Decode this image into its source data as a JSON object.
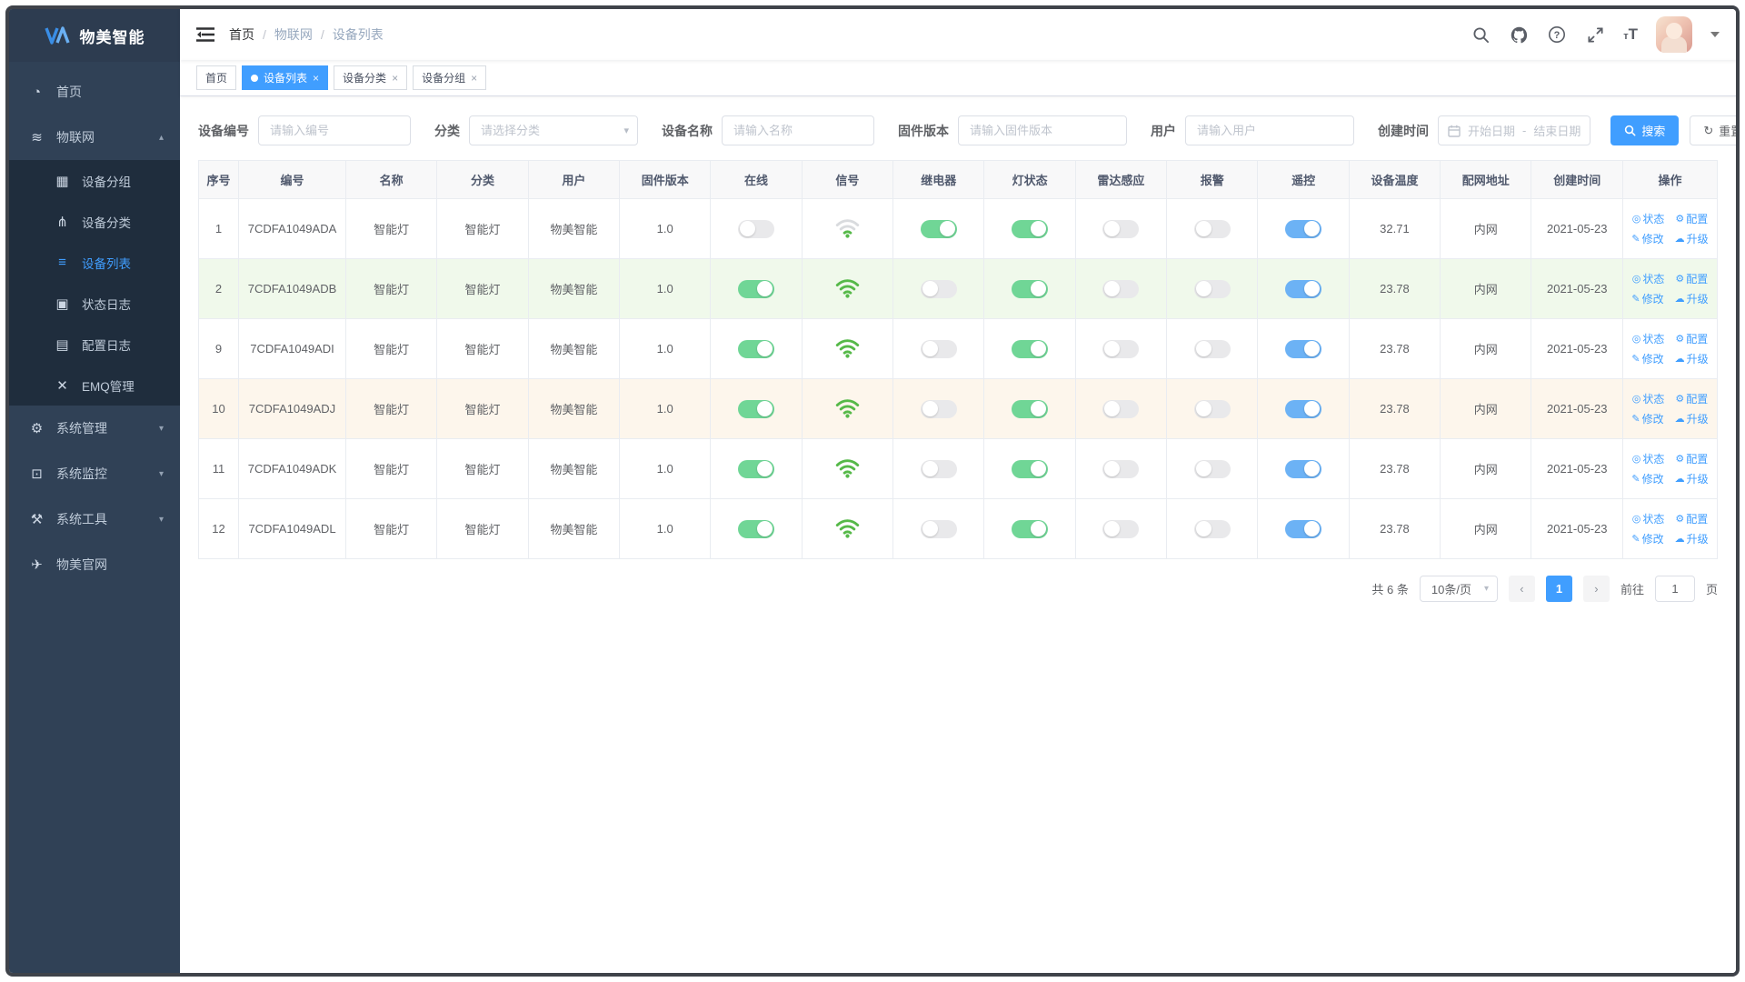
{
  "colors": {
    "accent": "#409eff",
    "toggle_green": "#70d696",
    "toggle_blue": "#6cb2f5",
    "toggle_off": "#e9e9eb",
    "wifi_green": "#56b949",
    "wifi_gray": "#d9dbde",
    "row_success": "#f0f9eb",
    "row_warning": "#fdf6ec"
  },
  "sidebar": {
    "logo_text": "物美智能",
    "items": [
      {
        "id": "home",
        "icon": "gauge-icon",
        "glyph": "◔",
        "label": "首页"
      },
      {
        "id": "iot",
        "icon": "wifi-icon",
        "glyph": "≋",
        "label": "物联网",
        "expanded": true,
        "children": [
          {
            "id": "device-group",
            "icon": "grid-icon",
            "glyph": "▦",
            "label": "设备分组"
          },
          {
            "id": "device-category",
            "icon": "tree-icon",
            "glyph": "⋔",
            "label": "设备分类"
          },
          {
            "id": "device-list",
            "icon": "list-icon",
            "glyph": "≡",
            "label": "设备列表",
            "active": true
          },
          {
            "id": "status-log",
            "icon": "status-log-icon",
            "glyph": "▣",
            "label": "状态日志"
          },
          {
            "id": "config-log",
            "icon": "config-log-icon",
            "glyph": "▤",
            "label": "配置日志"
          },
          {
            "id": "emq-admin",
            "icon": "emq-icon",
            "glyph": "✕",
            "label": "EMQ管理"
          }
        ]
      },
      {
        "id": "system-admin",
        "icon": "gear-icon",
        "glyph": "⚙",
        "label": "系统管理",
        "collapsible": true
      },
      {
        "id": "system-monitor",
        "icon": "monitor-icon",
        "glyph": "⊡",
        "label": "系统监控",
        "collapsible": true
      },
      {
        "id": "system-tools",
        "icon": "toolbox-icon",
        "glyph": "⚒",
        "label": "系统工具",
        "collapsible": true
      },
      {
        "id": "official-site",
        "icon": "paper-plane-icon",
        "glyph": "✈",
        "label": "物美官网"
      }
    ]
  },
  "navbar": {
    "breadcrumb": [
      "首页",
      "物联网",
      "设备列表"
    ],
    "right_icons": [
      "search-icon",
      "github-icon",
      "help-icon",
      "fullscreen-icon",
      "font-size-icon",
      "avatar",
      "caret-down-icon"
    ],
    "font_size_glyph_small": "т",
    "font_size_glyph_big": "T"
  },
  "tabs": [
    {
      "label": "首页",
      "active": false,
      "closable": false
    },
    {
      "label": "设备列表",
      "active": true,
      "closable": true
    },
    {
      "label": "设备分类",
      "active": false,
      "closable": true
    },
    {
      "label": "设备分组",
      "active": false,
      "closable": true
    }
  ],
  "filters": {
    "device_no": {
      "label": "设备编号",
      "placeholder": "请输入编号"
    },
    "category": {
      "label": "分类",
      "placeholder": "请选择分类"
    },
    "device_name": {
      "label": "设备名称",
      "placeholder": "请输入名称"
    },
    "firmware": {
      "label": "固件版本",
      "placeholder": "请输入固件版本"
    },
    "user": {
      "label": "用户",
      "placeholder": "请输入用户"
    },
    "created": {
      "label": "创建时间",
      "start_placeholder": "开始日期",
      "separator": "-",
      "end_placeholder": "结束日期"
    },
    "search_label": "搜索",
    "reset_label": "重置"
  },
  "table": {
    "columns": [
      "序号",
      "编号",
      "名称",
      "分类",
      "用户",
      "固件版本",
      "在线",
      "信号",
      "继电器",
      "灯状态",
      "雷达感应",
      "报警",
      "遥控",
      "设备温度",
      "配网地址",
      "创建时间",
      "操作"
    ],
    "actions": [
      {
        "icon": "status-icon",
        "glyph": "◎",
        "label": "状态"
      },
      {
        "icon": "config-icon",
        "glyph": "⚙",
        "label": "配置"
      },
      {
        "icon": "edit-icon",
        "glyph": "✎",
        "label": "修改"
      },
      {
        "icon": "upgrade-icon",
        "glyph": "☁",
        "label": "升级"
      }
    ],
    "rows": [
      {
        "index": "1",
        "code": "7CDFA1049ADA",
        "name": "智能灯",
        "category": "智能灯",
        "user": "物美智能",
        "firmware": "1.0",
        "online": false,
        "signal": "weak",
        "relay": true,
        "light": true,
        "radar": false,
        "alarm": false,
        "remote": true,
        "temperature": "32.71",
        "network": "内网",
        "created": "2021-05-23",
        "highlight": "none"
      },
      {
        "index": "2",
        "code": "7CDFA1049ADB",
        "name": "智能灯",
        "category": "智能灯",
        "user": "物美智能",
        "firmware": "1.0",
        "online": true,
        "signal": "full",
        "relay": false,
        "light": true,
        "radar": false,
        "alarm": false,
        "remote": true,
        "temperature": "23.78",
        "network": "内网",
        "created": "2021-05-23",
        "highlight": "success"
      },
      {
        "index": "9",
        "code": "7CDFA1049ADI",
        "name": "智能灯",
        "category": "智能灯",
        "user": "物美智能",
        "firmware": "1.0",
        "online": true,
        "signal": "full",
        "relay": false,
        "light": true,
        "radar": false,
        "alarm": false,
        "remote": true,
        "temperature": "23.78",
        "network": "内网",
        "created": "2021-05-23",
        "highlight": "none"
      },
      {
        "index": "10",
        "code": "7CDFA1049ADJ",
        "name": "智能灯",
        "category": "智能灯",
        "user": "物美智能",
        "firmware": "1.0",
        "online": true,
        "signal": "full",
        "relay": false,
        "light": true,
        "radar": false,
        "alarm": false,
        "remote": true,
        "temperature": "23.78",
        "network": "内网",
        "created": "2021-05-23",
        "highlight": "warning"
      },
      {
        "index": "11",
        "code": "7CDFA1049ADK",
        "name": "智能灯",
        "category": "智能灯",
        "user": "物美智能",
        "firmware": "1.0",
        "online": true,
        "signal": "full",
        "relay": false,
        "light": true,
        "radar": false,
        "alarm": false,
        "remote": true,
        "temperature": "23.78",
        "network": "内网",
        "created": "2021-05-23",
        "highlight": "none"
      },
      {
        "index": "12",
        "code": "7CDFA1049ADL",
        "name": "智能灯",
        "category": "智能灯",
        "user": "物美智能",
        "firmware": "1.0",
        "online": true,
        "signal": "full",
        "relay": false,
        "light": true,
        "radar": false,
        "alarm": false,
        "remote": true,
        "temperature": "23.78",
        "network": "内网",
        "created": "2021-05-23",
        "highlight": "none"
      }
    ]
  },
  "pagination": {
    "total": "共 6 条",
    "page_size": "10条/页",
    "prev": "‹",
    "next": "›",
    "current": "1",
    "goto_label": "前往",
    "page_suffix": "页"
  }
}
